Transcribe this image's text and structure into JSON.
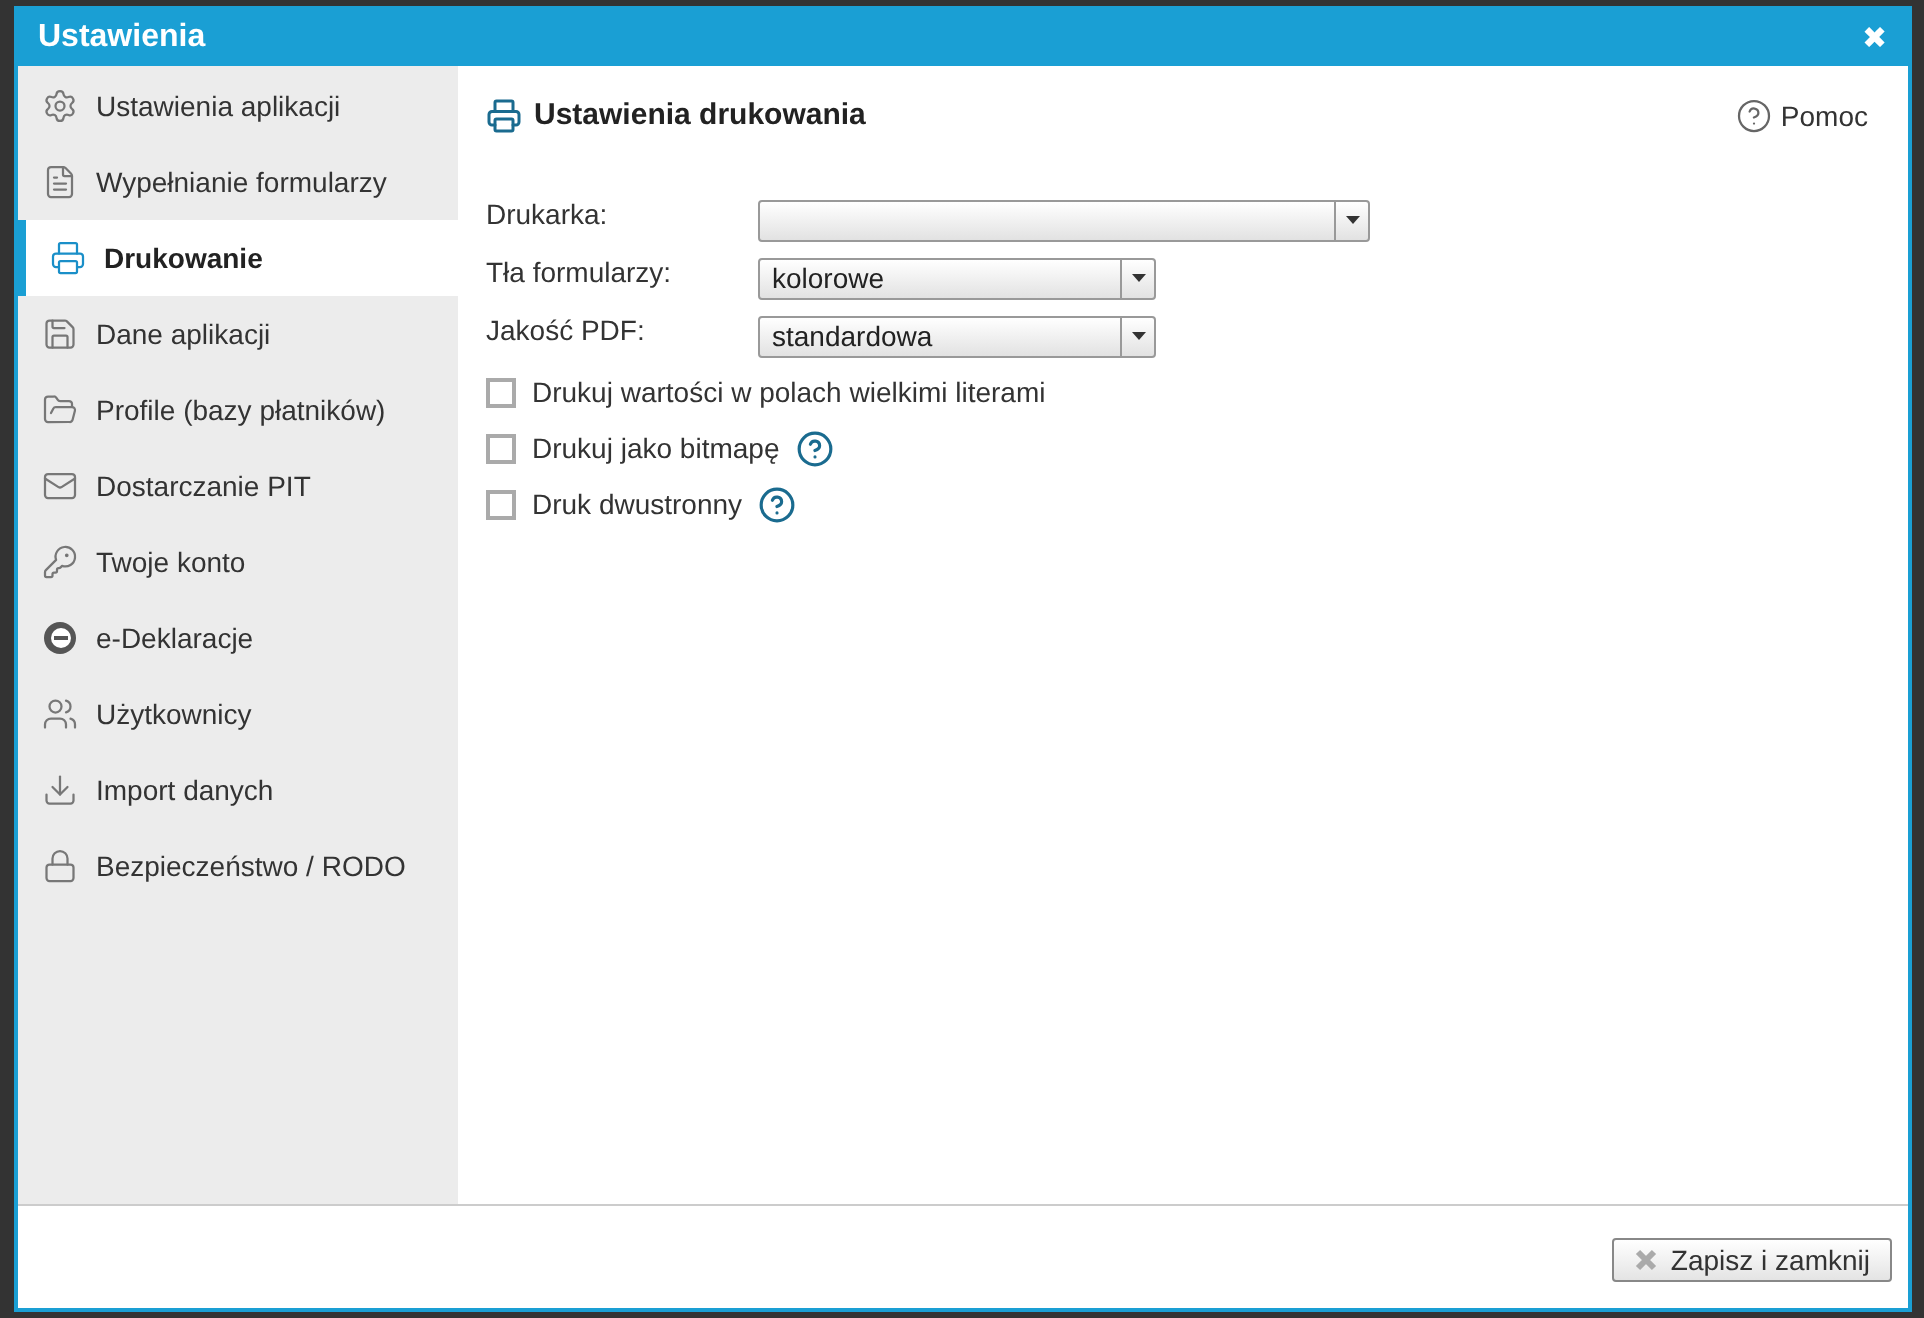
{
  "window": {
    "title": "Ustawienia",
    "close": "✖"
  },
  "sidebar": {
    "items": [
      {
        "label": "Ustawienia aplikacji",
        "kind": "gear",
        "selected": false
      },
      {
        "label": "Wypełnianie formularzy",
        "kind": "form",
        "selected": false
      },
      {
        "label": "Drukowanie",
        "kind": "printer",
        "selected": true
      },
      {
        "label": "Dane aplikacji",
        "kind": "disk",
        "selected": false
      },
      {
        "label": "Profile (bazy płatników)",
        "kind": "folder",
        "selected": false
      },
      {
        "label": "Dostarczanie PIT",
        "kind": "mail",
        "selected": false
      },
      {
        "label": "Twoje konto",
        "kind": "key",
        "selected": false
      },
      {
        "label": "e-Deklaracje",
        "kind": "e",
        "selected": false
      },
      {
        "label": "Użytkownicy",
        "kind": "users",
        "selected": false
      },
      {
        "label": "Import danych",
        "kind": "import",
        "selected": false
      },
      {
        "label": "Bezpieczeństwo / RODO",
        "kind": "lock",
        "selected": false
      }
    ]
  },
  "panel": {
    "title": "Ustawienia drukowania",
    "help": "Pomoc",
    "fields": [
      {
        "label": "Drukarka:",
        "wide": true
      },
      {
        "label": "Tła formularzy:",
        "value": "kolorowe",
        "wide": false
      },
      {
        "label": "Jakość PDF:",
        "value": "standardowa",
        "wide": false
      }
    ],
    "options": [
      {
        "label": "Drukuj wartości w polach wielkimi literami",
        "checked": false,
        "help": false
      },
      {
        "label": "Drukuj jako bitmapę",
        "checked": false,
        "help": true
      },
      {
        "label": "Druk dwustronny",
        "checked": false,
        "help": true
      }
    ]
  },
  "footer": {
    "button": "Zapisz i zamknij"
  }
}
